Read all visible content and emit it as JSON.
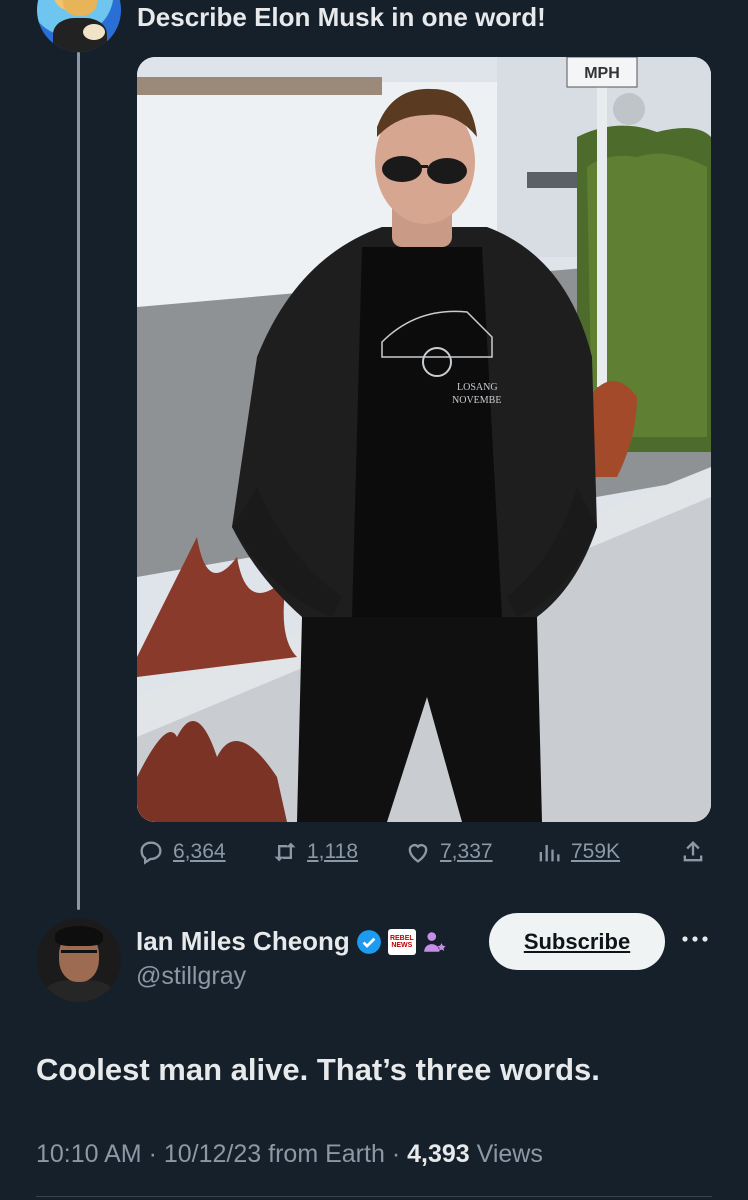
{
  "original_tweet": {
    "text": "Describe Elon Musk in one word!",
    "avatar_icon": "doge-avatar-icon",
    "media": {
      "sign_text": "MPH",
      "shirt_text_line1": "LOSANG",
      "shirt_text_line2": "NOVEMBE"
    },
    "stats": {
      "replies": "6,364",
      "reposts": "1,118",
      "likes": "7,337",
      "views": "759K"
    }
  },
  "reply": {
    "display_name": "Ian Miles Cheong",
    "handle": "@stillgray",
    "badge_text": "REBEL NEWS",
    "subscribe_label": "Subscribe",
    "text": "Coolest man alive. That’s three words.",
    "time": "10:10 AM",
    "date": "10/12/23",
    "source": "from Earth",
    "views_count": "4,393",
    "views_label": "Views",
    "separator": "·"
  },
  "colors": {
    "background": "#15202b",
    "text_primary": "#e7e9ea",
    "text_secondary": "#8b98a5",
    "verified": "#1d9bf0",
    "subscribe_bg": "#eff3f4"
  }
}
